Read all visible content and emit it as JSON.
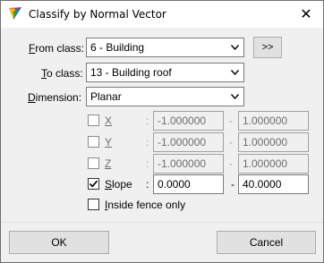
{
  "window": {
    "title": "Classify by Normal Vector",
    "close_glyph": "✕"
  },
  "form": {
    "from_class": {
      "label": "From class:",
      "accesskey": "F",
      "rest": "rom class:",
      "value": "6 - Building"
    },
    "more_button": {
      "label": ">>"
    },
    "to_class": {
      "label": "To class:",
      "accesskey": "T",
      "rest": "o class:",
      "value": "13 - Building roof"
    },
    "dimension": {
      "label": "Dimension:",
      "accesskey": "D",
      "rest": "imension:",
      "value": "Planar"
    },
    "rows": [
      {
        "key": "X",
        "checked": false,
        "enabled": false,
        "min": "-1.000000",
        "max": "1.000000"
      },
      {
        "key": "Y",
        "checked": false,
        "enabled": false,
        "min": "-1.000000",
        "max": "1.000000"
      },
      {
        "key": "Z",
        "checked": false,
        "enabled": false,
        "min": "-1.000000",
        "max": "1.000000"
      },
      {
        "key": "Slope",
        "accesskey": "S",
        "rest": "lope",
        "checked": true,
        "enabled": true,
        "min": "0.0000",
        "max": "40.0000"
      }
    ],
    "separator_colon": ":",
    "separator_dash": "-",
    "inside_fence": {
      "label": "Inside fence only",
      "accesskey": "I",
      "rest": "nside fence only",
      "checked": false
    }
  },
  "footer": {
    "ok_label": "OK",
    "cancel_label": "Cancel"
  },
  "colors": {
    "title_bg": "#ffffff",
    "dialog_bg": "#f0f0f0",
    "button_bg": "#e1e1e1"
  },
  "icons": {
    "app": "microstation-tool-icon",
    "dropdown": "chevron-down-icon",
    "check": "check-icon"
  }
}
